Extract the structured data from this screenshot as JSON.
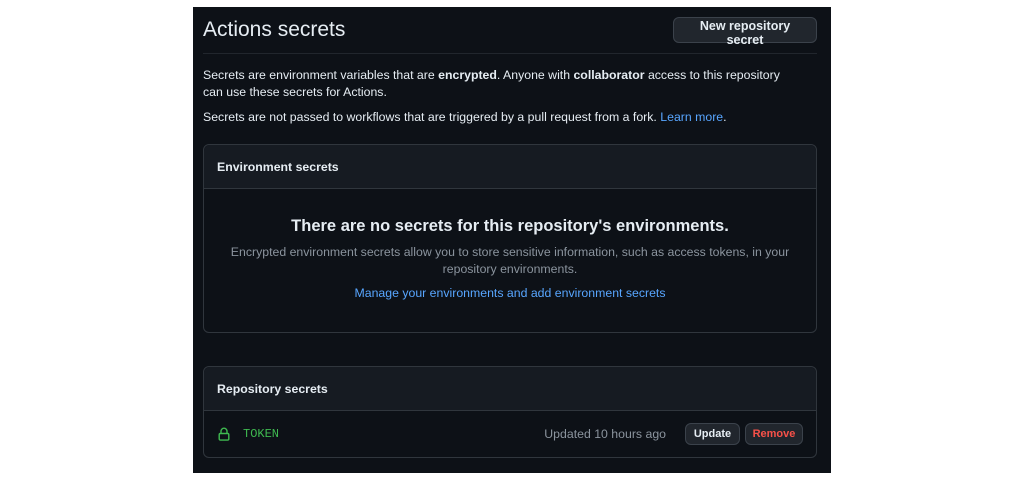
{
  "header": {
    "title": "Actions secrets",
    "new_secret_button": "New repository secret"
  },
  "description": {
    "line1_part1": "Secrets are environment variables that are ",
    "line1_bold1": "encrypted",
    "line1_part2": ". Anyone with ",
    "line1_bold2": "collaborator",
    "line1_part3": " access to this repository can use these secrets for Actions.",
    "line2_text": "Secrets are not passed to workflows that are triggered by a pull request from a fork. ",
    "line2_link": "Learn more",
    "line2_end": "."
  },
  "environment_secrets": {
    "title": "Environment secrets",
    "blank_title": "There are no secrets for this repository's environments.",
    "blank_text": "Encrypted environment secrets allow you to store sensitive information, such as access tokens, in your repository environments.",
    "manage_link": "Manage your environments and add environment secrets"
  },
  "repository_secrets": {
    "title": "Repository secrets",
    "items": [
      {
        "icon": "lock-icon",
        "name": "TOKEN",
        "updated": "Updated 10 hours ago",
        "update_label": "Update",
        "remove_label": "Remove"
      }
    ]
  },
  "colors": {
    "background": "#0d1117",
    "link": "#58a6ff",
    "secret_name": "#3fb950",
    "danger": "#f85149"
  }
}
